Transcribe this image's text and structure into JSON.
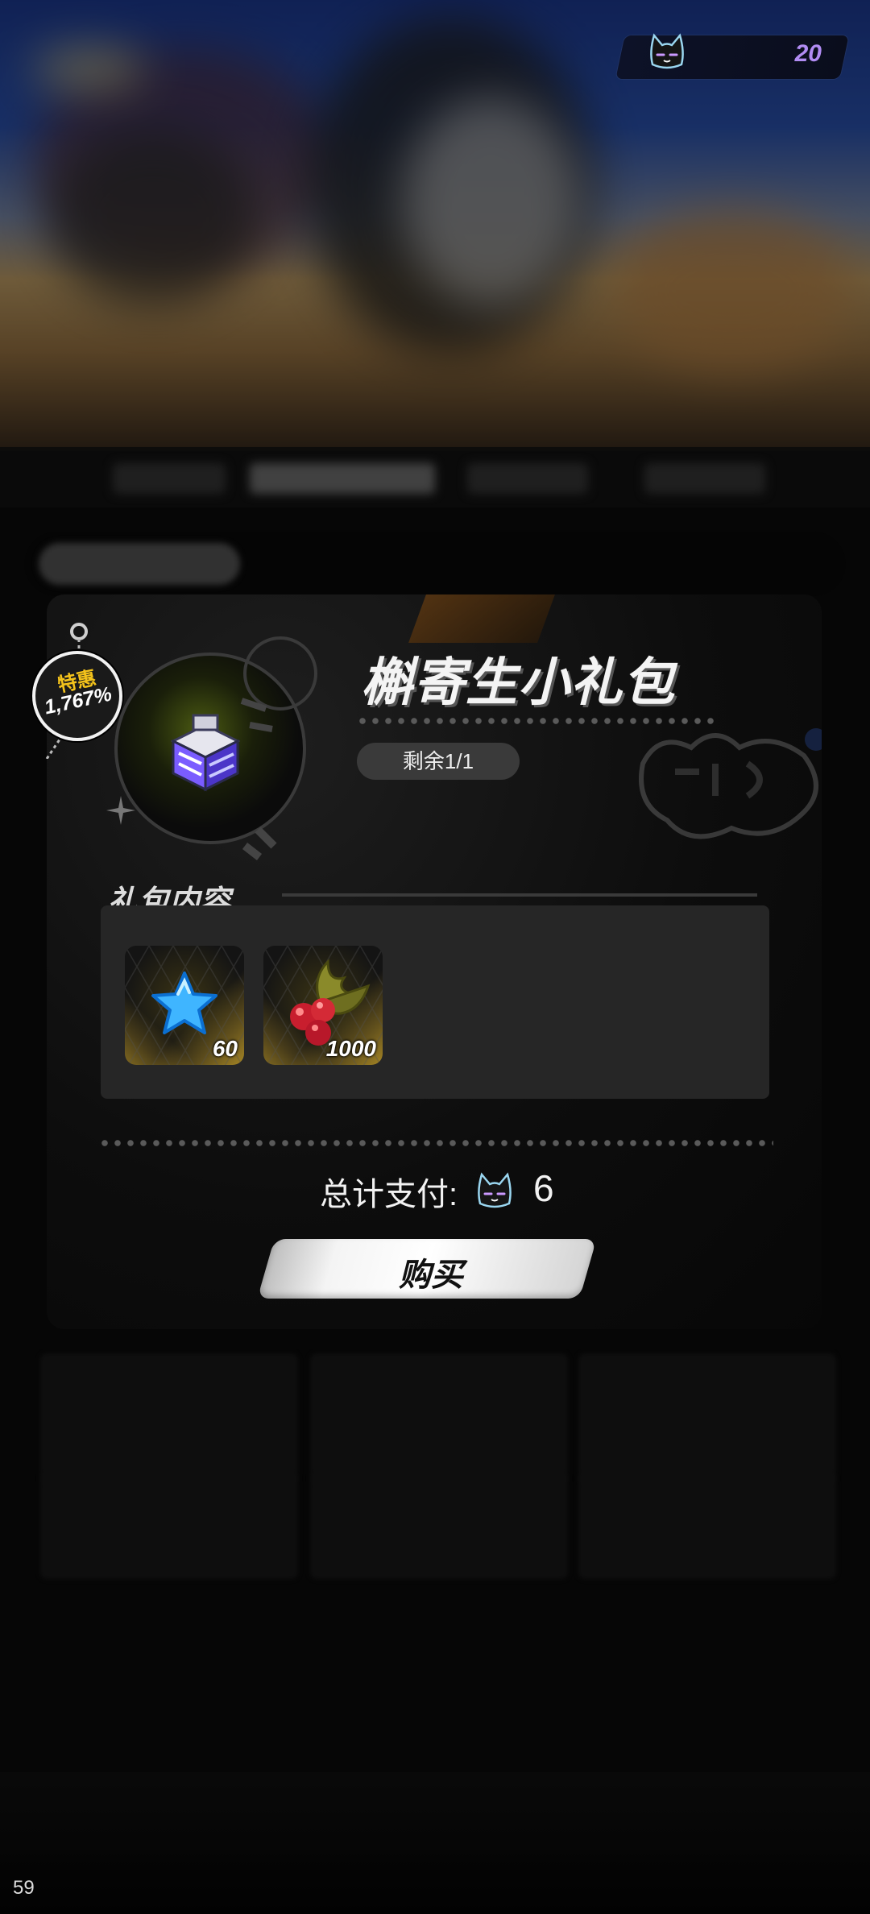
{
  "header": {
    "currency_count": "20"
  },
  "modal": {
    "discount_tag": {
      "title": "特惠",
      "percent": "1,767%"
    },
    "pack_title": "槲寄生小礼包",
    "remaining": "剩余1/1",
    "contents_label": "礼包内容",
    "rewards": [
      {
        "icon": "blue-star-icon",
        "quantity": "60"
      },
      {
        "icon": "mistletoe-berries-icon",
        "quantity": "1000"
      }
    ],
    "total_label": "总计支付:",
    "total_amount": "6",
    "buy_label": "购买"
  },
  "fps": "59",
  "colors": {
    "accent_purple": "#b18cf3",
    "tag_yellow": "#f3c21b",
    "modal_bg": "#0d0d0d"
  }
}
